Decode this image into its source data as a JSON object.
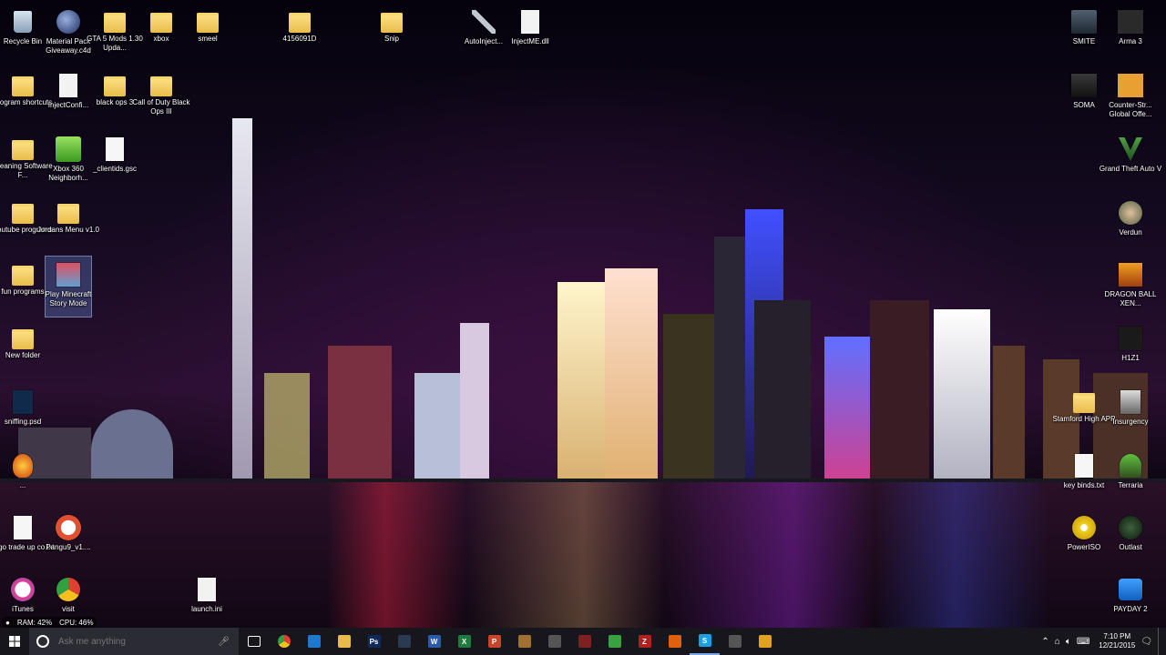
{
  "desktop_icons": [
    {
      "id": "recycle-bin",
      "label": "Recycle Bin",
      "icon": "recycle-bin-icon"
    },
    {
      "id": "material-pack",
      "label": "Material Pack Giveaway.c4d",
      "icon": "cinema4d-icon"
    },
    {
      "id": "gta5-mods",
      "label": "GTA 5 Mods 1.30 Upda...",
      "icon": "folder-icon"
    },
    {
      "id": "xbox",
      "label": "xbox",
      "icon": "folder-icon"
    },
    {
      "id": "smeel",
      "label": "smeel",
      "icon": "folder-icon"
    },
    {
      "id": "4156091d",
      "label": "4156091D",
      "icon": "folder-icon"
    },
    {
      "id": "snip",
      "label": "Snip",
      "icon": "folder-icon"
    },
    {
      "id": "autoinject",
      "label": "AutoInject...",
      "icon": "syringe-icon"
    },
    {
      "id": "injectme-dll",
      "label": "InjectME.dll",
      "icon": "dll-file-icon"
    },
    {
      "id": "program-shortcuts",
      "label": "program shortcuts",
      "icon": "folder-icon"
    },
    {
      "id": "injectconfig",
      "label": "InjectConfi...",
      "icon": "config-file-icon"
    },
    {
      "id": "black-ops-3",
      "label": "black ops 3",
      "icon": "folder-icon"
    },
    {
      "id": "cod-bo3",
      "label": "Call of Duty Black Ops III",
      "icon": "folder-icon"
    },
    {
      "id": "cleaning-software",
      "label": "Cleaning Software F...",
      "icon": "folder-icon"
    },
    {
      "id": "xbox360-neighborhood",
      "label": "Xbox 360 Neighborh...",
      "icon": "xbox360-icon"
    },
    {
      "id": "clientids",
      "label": "_clientids.gsc",
      "icon": "text-file-icon"
    },
    {
      "id": "youtube-programs",
      "label": "Youtube programs",
      "icon": "folder-icon"
    },
    {
      "id": "jordans-menu",
      "label": "Jordans Menu v1.0",
      "icon": "folder-icon"
    },
    {
      "id": "fun-programs",
      "label": "fun programs",
      "icon": "folder-icon"
    },
    {
      "id": "minecraft-story",
      "label": "Play Minecraft Story Mode",
      "icon": "minecraft-icon"
    },
    {
      "id": "new-folder",
      "label": "New folder",
      "icon": "folder-icon"
    },
    {
      "id": "sniffing-psd",
      "label": "sniffing.psd",
      "icon": "photoshop-file-icon"
    },
    {
      "id": "unknown-flame",
      "label": "...",
      "icon": "flame-icon"
    },
    {
      "id": "csgo-trade",
      "label": "csgo trade up co.txt",
      "icon": "text-file-icon"
    },
    {
      "id": "pangu9",
      "label": "Pangu9_v1....",
      "icon": "pangu-icon"
    },
    {
      "id": "itunes",
      "label": "iTunes",
      "icon": "itunes-icon"
    },
    {
      "id": "visit",
      "label": "visit",
      "icon": "chrome-icon"
    },
    {
      "id": "launch-ini",
      "label": "launch.ini",
      "icon": "config-file-icon"
    },
    {
      "id": "smite",
      "label": "SMITE",
      "icon": "smite-icon"
    },
    {
      "id": "arma3",
      "label": "Arma 3",
      "icon": "arma-icon"
    },
    {
      "id": "soma",
      "label": "SOMA",
      "icon": "soma-icon"
    },
    {
      "id": "csgo",
      "label": "Counter-Str... Global Offe...",
      "icon": "csgo-icon"
    },
    {
      "id": "gta5",
      "label": "Grand Theft Auto V",
      "icon": "gta-icon"
    },
    {
      "id": "verdun",
      "label": "Verdun",
      "icon": "verdun-icon"
    },
    {
      "id": "dragonball",
      "label": "DRAGON BALL XEN...",
      "icon": "dragonball-icon"
    },
    {
      "id": "h1z1",
      "label": "H1Z1",
      "icon": "h1z1-icon"
    },
    {
      "id": "stamford-app",
      "label": "Stamford High APP",
      "icon": "folder-icon"
    },
    {
      "id": "insurgency",
      "label": "Insurgency",
      "icon": "insurgency-icon"
    },
    {
      "id": "key-binds",
      "label": "key binds.txt",
      "icon": "text-file-icon"
    },
    {
      "id": "terraria",
      "label": "Terraria",
      "icon": "terraria-icon"
    },
    {
      "id": "poweriso",
      "label": "PowerISO",
      "icon": "poweriso-icon"
    },
    {
      "id": "outlast",
      "label": "Outlast",
      "icon": "outlast-icon"
    },
    {
      "id": "payday2",
      "label": "PAYDAY 2",
      "icon": "payday-icon"
    }
  ],
  "sysmon": {
    "ram": "RAM: 42%",
    "cpu": "CPU: 46%"
  },
  "taskbar": {
    "search_placeholder": "Ask me anything",
    "apps": [
      {
        "name": "task-view",
        "icon": "task-view-icon"
      },
      {
        "name": "chrome",
        "icon": "chrome-icon"
      },
      {
        "name": "edge",
        "icon": "edge-icon"
      },
      {
        "name": "file-explorer",
        "icon": "folder-icon"
      },
      {
        "name": "photoshop",
        "icon": "photoshop-icon",
        "text": "Ps"
      },
      {
        "name": "steam",
        "icon": "steam-icon"
      },
      {
        "name": "word",
        "icon": "word-icon",
        "text": "W"
      },
      {
        "name": "excel",
        "icon": "excel-icon",
        "text": "X"
      },
      {
        "name": "powerpoint",
        "icon": "powerpoint-icon",
        "text": "P"
      },
      {
        "name": "unknown-folder-app",
        "icon": "folder-app-icon"
      },
      {
        "name": "store",
        "icon": "store-icon"
      },
      {
        "name": "unknown-red-app",
        "icon": "gear-red-icon"
      },
      {
        "name": "green-app",
        "icon": "green-app-icon"
      },
      {
        "name": "filezilla",
        "icon": "filezilla-icon",
        "text": "Z"
      },
      {
        "name": "flame-app",
        "icon": "flame-icon"
      },
      {
        "name": "skype",
        "icon": "skype-icon",
        "text": "S"
      },
      {
        "name": "pen-app",
        "icon": "pen-icon"
      },
      {
        "name": "recorder",
        "icon": "record-icon"
      }
    ],
    "clock_time": "7:10 PM",
    "clock_date": "12/21/2015"
  },
  "colors": {
    "taskbar": "#16161c",
    "search": "#2b2b33",
    "folder": "#f0c75a",
    "accent": "#7aa7e6"
  }
}
